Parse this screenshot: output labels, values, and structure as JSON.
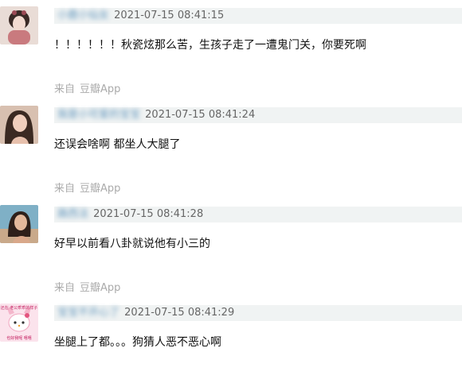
{
  "comments": [
    {
      "author": "小鹿小仙女",
      "time": "2021-07-15 08:41:15",
      "text": "！！！！！！秋瓷炫那么苦，生孩子走了一遭鬼门关，你要死啊",
      "source_prefix": "来自",
      "source_app": "豆瓣App"
    },
    {
      "author": "我是小可爱的宝宝",
      "time": "2021-07-15 08:41:24",
      "text": "还误会啥啊 都坐人大腿了",
      "source_prefix": "来自",
      "source_app": "豆瓣App"
    },
    {
      "author": "路西法",
      "time": "2021-07-15 08:41:28",
      "text": "好早以前看八卦就说他有小三的",
      "source_prefix": "来自",
      "source_app": "豆瓣App"
    },
    {
      "author": "宝宝不开心了",
      "time": "2021-07-15 08:41:29",
      "text": "坐腿上了都。。。狗猜人恶不恶心啊",
      "source_prefix": "",
      "source_app": ""
    }
  ],
  "avatar_text": {
    "top": "还在 老公乖乖的样子",
    "bottom": "也好我呢 嘻嘻"
  }
}
